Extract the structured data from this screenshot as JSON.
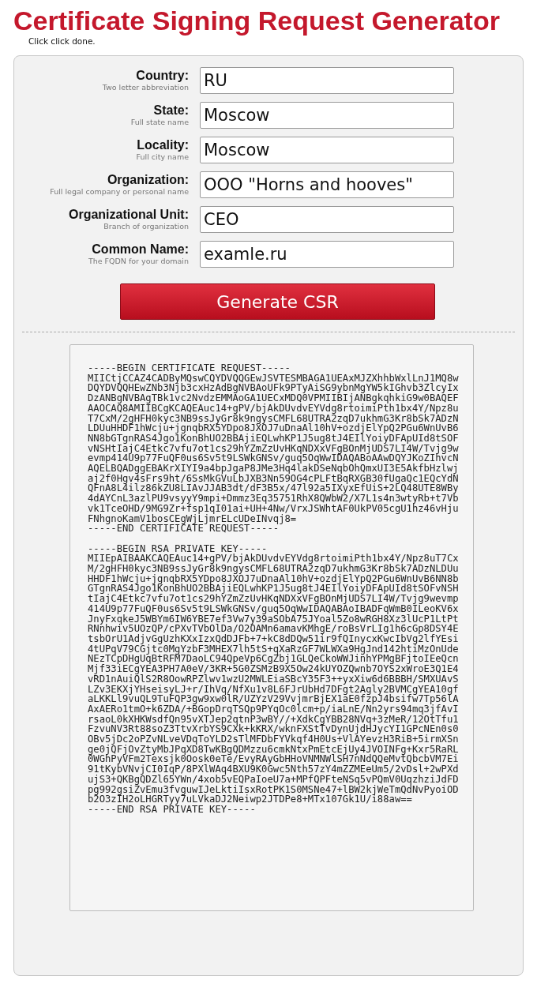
{
  "title": "Certificate Signing Request Generator",
  "subtitle": "Click click done.",
  "fields": [
    {
      "label": "Country:",
      "hint": "Two letter abbreviation",
      "value": "RU"
    },
    {
      "label": "State:",
      "hint": "Full state name",
      "value": "Moscow"
    },
    {
      "label": "Locality:",
      "hint": "Full city name",
      "value": "Moscow"
    },
    {
      "label": "Organization:",
      "hint": "Full legal company or personal name",
      "value": "OOO \"Horns and hooves\""
    },
    {
      "label": "Organizational Unit:",
      "hint": "Branch of organization",
      "value": "CEO"
    },
    {
      "label": "Common Name:",
      "hint": "The FQDN for your domain",
      "value": "examle.ru"
    }
  ],
  "button": "Generate CSR",
  "output": "-----BEGIN CERTIFICATE REQUEST-----\nMIICtjCCAZ4CADByMQswCQYDVQQGEwJSVTESMBAGA1UEAxMJZXhhbWxlLnJ1MQ8w\nDQYDVQQHEwZNb3Njb3cxHzAdBgNVBAoUFk9PTyAiSG9ybnMgYW5kIGhvb3ZlcyIx\nDzANBgNVBAgTBk1vc2NvdzEMMAoGA1UECxMDQ0VPMIIBIjANBgkqhkiG9w0BAQEF\nAAOCAQ8AMIIBCgKCAQEAuc14+gPV/bjAkDUvdvEYVdg8rtoimiPth1bx4Y/Npz8u\nT7CxM/2gHFH0kyc3NB9ssJyGr8k9ngysCMFL68UTRA2zqD7ukhmG3Kr8bSk7ADzN\nLDUuHHDF1hWcju+jgnqbRX5YDpo8JXOJ7uDnaAl10hV+ozdjElYpQ2PGu6WnUvB6\nNN8bGTgnRAS4Jgo1KonBhUO2BBAjiEQLwhKP1J5ug8tJ4EIlYoiyDFApUId8tSOF\nvNSHtIajC4Etkc7vfu7ot1cs29hYZmZzUvHKqNDXxVFgBOnMjUDS7LI4W/Tvjg9w\nevmp414U9p77FuQF0us6Sv5t9LSWkGNSv/guq5OqWwIDAQABoAAwDQYJKoZIhvcN\nAQELBQADggEBAKrXIYI9a4bpJgaP8JMe3Hq4lakDSeNqbOhQmxUI3E5AkfbHzlwj\naj2f0Hgv4sFrs9ht/6SsMkGVuLbJXB3Nn59OG4cPLFtBqRXGB30fUgaQc1EQcYdN\nQFnA8L4ilz86kZU8LIAvJJAB3dt/dF3B5x/47l92a5IXyxEfUiS+2LQ48UTE8WBy\n4dAYCnL3azlPU9vsyyY9mpi+Dmmz3Eq35751RhX8QWbW2/X7L1s4n3wtyRb+t7Vb\nvk1TceOHD/9MG9Zr+fsp1qI01ai+UH+4Nw/VrxJSWhtAF0UkPV05cgU1hz46vHju\nFNhgnoKamV1bosCEgWjLjmrELcUDeINvqj8=\n-----END CERTIFICATE REQUEST-----\n\n-----BEGIN RSA PRIVATE KEY-----\nMIIEpAIBAAKCAQEAuc14+gPV/bjAkDUvdvEYVdg8rtoimiPth1bx4Y/Npz8uT7Cx\nM/2gHFH0kyc3NB9ssJyGr8k9ngysCMFL68UTRA2zqD7ukhmG3Kr8bSk7ADzNLDUu\nHHDF1hWcju+jgnqbRX5YDpo8JXOJ7uDnaAl10hV+ozdjElYpQ2PGu6WnUvB6NN8b\nGTgnRAS4Jgo1KonBhUO2BBAjiEQLwhKP1J5ug8tJ4EIlYoiyDFApUId8tSOFvNSH\ntIajC4Etkc7vfu7ot1cs29hYZmZzUvHKqNDXxVFgBOnMjUDS7LI4W/Tvjg9wevmp\n414U9p77FuQF0us6Sv5t9LSWkGNSv/guq5OqWwIDAQABAoIBADFqWmB0ILeoKV6x\nJnyFxqkeJ5WBYm6IW6YBE7ef3Vw7y39aSObA75JYoal5Zo8wRGH8Xz3lUcP1LtPt\nRNnhwiv5UOzQP/cPXvTVbOlDa/O2OAMn6amavKMhgE/roBsVrLIg1h6cGp8DSY4E\ntsbOrU1AdjvGgUzhKXxIzxQdDJFb+7+kC8dDQw51ir9fQInycxKwcIbVg2lfYEsi\n4tUPqV79CGjtc0MgYzbF3MHEX7lh5tS+qXaRzGF7WLWXa9HgJnd142htiMzOnUde\nNEzTCpDHgUqBtRFM7DaoLC94QpeVp6CgZbj1GLQeCkoWWJinhYPMgBFjtoIEeQcn\nMjf33iECgYEA3PH7A0eV/3KR+5G0ZSMzB9X5Ow24kUYOZQwnb7OYS2xWroE3Q1E4\nvRD1nAuiQlS2R8OowRPZlwv1wzU2MWLEiaSBcY35F3++yxXiw6d6BBBH/SMXUAvS\nLZv3EKXjYHseisyLJ+r/IhVq/NfXu1v8L6FJrUbHd7DFgt2Agly2BVMCgYEA10gf\naLKKLl9vuQL9TuFQP3gw9xw0lR/UZYzV29VvjmrBjEX1aE0fzpJ4bsifw7Tp56lA\nAxAERo1tmO+k6ZDA/+BGopDrqTSQp9PYqOc0lcm+p/iaLnE/Nn2yrs94mq3jfAvI\nrsaoL0kXHKWsdfQn95vXTJep2qtnP3wBY//+XdkCgYBB28NVq+3zMeR/12OtTfu1\nFzvuNV3Rt88soZ3TtvXrbYS9CXk+kKRX/wknFXStTvDynUjdHJycYI1GPcNEn0s0\nOBv5jDc2oPZvNLveVDqToYLD2sTlMFDbFYVkqf4H0Us+VlAYevzH3RiB+5irmXSn\nge0jQFjOvZtyMbJPqXD8TwKBgQDMzzu6cmkNtxPmEtcEjUy4JVOINFg+Kxr5RaRL\n0WGhPyVFm2Texsjk0Oosk0eTe/EvyRAyGbHHoVNMNWlSH7nNdQQeMvtQbcbVM7Ei\n91tKybVNvjCI0IqP/8PXlWAq4BXU9K0Gwc5Nth57zY4mZZMEeUm5/2vDsl+2wPXd\nujS3+QKBgQDZl65YWn/4xob5vEQPaIoeU7a+MPfQPFteNSq5vPQmV0UqzhziJdFD\npg992gsiZvEmu3fvguwIJeLktiIsxRotPK1S0MSNe47+lBW2kjWeTmQdNvPyoiOD\nb2O3zIH2oLHGRTyy7uLVkaDJ2Neiwp2JTDPe8+MTx107Gk1U/i88aw==\n-----END RSA PRIVATE KEY-----"
}
